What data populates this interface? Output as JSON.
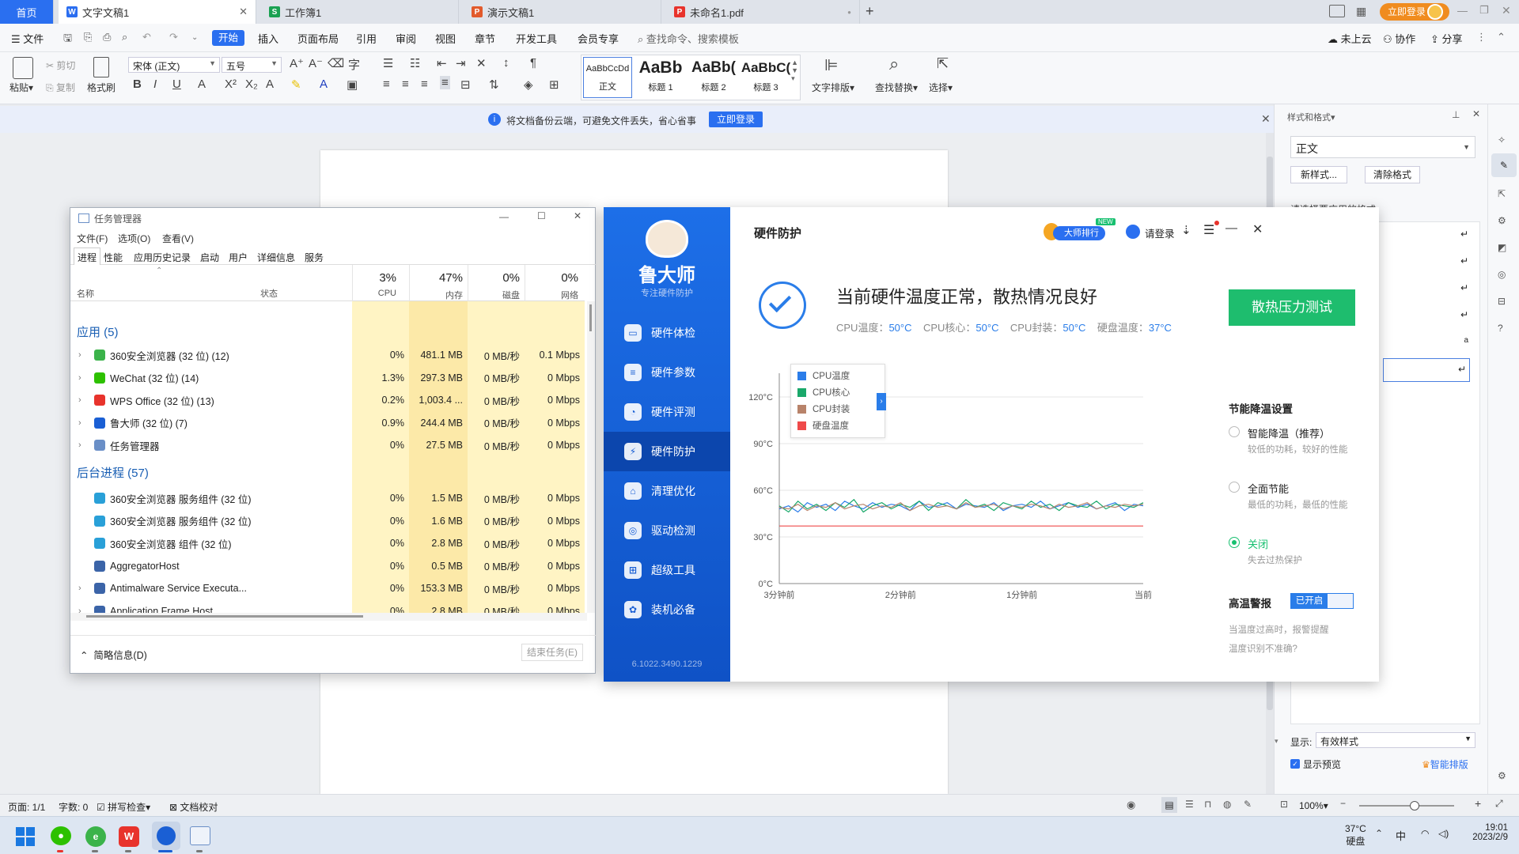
{
  "tabs": [
    {
      "label": "首页",
      "icon": "home"
    },
    {
      "label": "文字文稿1",
      "icon": "W"
    },
    {
      "label": "工作簿1",
      "icon": "S"
    },
    {
      "label": "演示文稿1",
      "icon": "P"
    },
    {
      "label": "未命名1.pdf",
      "icon": "pdf"
    }
  ],
  "titlebar": {
    "login": "立即登录"
  },
  "menu": {
    "file": "文件",
    "start": "开始",
    "items": [
      "插入",
      "页面布局",
      "引用",
      "审阅",
      "视图",
      "章节",
      "开发工具",
      "会员专享"
    ],
    "search": "查找命令、搜索模板",
    "cloud": "未上云",
    "collab": "协作",
    "share": "分享"
  },
  "ribbon": {
    "paste": "粘贴",
    "cut": "剪切",
    "copy": "复制",
    "format_painter": "格式刷",
    "font": "宋体 (正文)",
    "size": "五号",
    "styles": [
      {
        "preview": "AaBbCcDd",
        "label": "正文"
      },
      {
        "preview": "AaBb",
        "label": "标题 1"
      },
      {
        "preview": "AaBb(",
        "label": "标题 2"
      },
      {
        "preview": "AaBbC(",
        "label": "标题 3"
      }
    ],
    "text_layout": "文字排版",
    "find_replace": "查找替换",
    "select": "选择"
  },
  "notice": {
    "text": "将文档备份云端，可避免文件丢失，省心省事",
    "button": "立即登录"
  },
  "styles_pane": {
    "title": "样式和格式",
    "current": "正文",
    "new_style": "新样式...",
    "clear_format": "清除格式",
    "hint": "请选择要应用的格式",
    "show_label": "显示:",
    "show_value": "有效样式",
    "preview": "显示预览",
    "smart": "智能排版"
  },
  "status": {
    "page": "页面: 1/1",
    "words": "字数: 0",
    "spell": "拼写检查",
    "proof": "文档校对",
    "zoom": "100%"
  },
  "taskbar": {
    "temp": "37°C",
    "temp_label": "硬盘",
    "ime": "中",
    "time": "19:01",
    "date": "2023/2/9"
  },
  "task_manager": {
    "title": "任务管理器",
    "menus": [
      "文件(F)",
      "选项(O)",
      "查看(V)"
    ],
    "tabs": [
      "进程",
      "性能",
      "应用历史记录",
      "启动",
      "用户",
      "详细信息",
      "服务"
    ],
    "columns": {
      "name": "名称",
      "status": "状态",
      "cpu_pct": "3%",
      "cpu": "CPU",
      "mem_pct": "47%",
      "mem": "内存",
      "disk_pct": "0%",
      "disk": "磁盘",
      "net_pct": "0%",
      "net": "网络"
    },
    "apps_header": "应用 (5)",
    "apps": [
      {
        "name": "360安全浏览器 (32 位) (12)",
        "cpu": "0%",
        "mem": "481.1 MB",
        "disk": "0 MB/秒",
        "net": "0.1 Mbps",
        "color": "#3bb34a"
      },
      {
        "name": "WeChat (32 位) (14)",
        "cpu": "1.3%",
        "mem": "297.3 MB",
        "disk": "0 MB/秒",
        "net": "0 Mbps",
        "color": "#2dc100"
      },
      {
        "name": "WPS Office (32 位) (13)",
        "cpu": "0.2%",
        "mem": "1,003.4 ...",
        "disk": "0 MB/秒",
        "net": "0 Mbps",
        "color": "#e8332c"
      },
      {
        "name": "鲁大师 (32 位) (7)",
        "cpu": "0.9%",
        "mem": "244.4 MB",
        "disk": "0 MB/秒",
        "net": "0 Mbps",
        "color": "#1a5fd4"
      },
      {
        "name": "任务管理器",
        "cpu": "0%",
        "mem": "27.5 MB",
        "disk": "0 MB/秒",
        "net": "0 Mbps",
        "color": "#6a8fc7"
      }
    ],
    "bg_header": "后台进程 (57)",
    "bg": [
      {
        "name": "360安全浏览器 服务组件 (32 位)",
        "cpu": "0%",
        "mem": "1.5 MB",
        "disk": "0 MB/秒",
        "net": "0 Mbps",
        "color": "#29a0d8"
      },
      {
        "name": "360安全浏览器 服务组件 (32 位)",
        "cpu": "0%",
        "mem": "1.6 MB",
        "disk": "0 MB/秒",
        "net": "0 Mbps",
        "color": "#29a0d8"
      },
      {
        "name": "360安全浏览器 组件 (32 位)",
        "cpu": "0%",
        "mem": "2.8 MB",
        "disk": "0 MB/秒",
        "net": "0 Mbps",
        "color": "#29a0d8"
      },
      {
        "name": "AggregatorHost",
        "cpu": "0%",
        "mem": "0.5 MB",
        "disk": "0 MB/秒",
        "net": "0 Mbps",
        "color": "#3b64a8"
      },
      {
        "name": "Antimalware Service Executa...",
        "cpu": "0%",
        "mem": "153.3 MB",
        "disk": "0 MB/秒",
        "net": "0 Mbps",
        "color": "#3b64a8"
      },
      {
        "name": "Application Frame Host",
        "cpu": "0%",
        "mem": "2.8 MB",
        "disk": "0 MB/秒",
        "net": "0 Mbps",
        "color": "#3b64a8"
      }
    ],
    "fewer": "简略信息(D)",
    "end_task": "结束任务(E)"
  },
  "ludashi": {
    "brand": "鲁大师",
    "slogan": "专注硬件防护",
    "version": "6.1022.3490.1229",
    "nav": [
      "硬件体检",
      "硬件参数",
      "硬件评测",
      "硬件防护",
      "清理优化",
      "驱动检测",
      "超级工具",
      "装机必备"
    ],
    "page_title": "硬件防护",
    "rank": "大师排行",
    "rank_badge": "NEW",
    "login": "请登录",
    "status_title": "当前硬件温度正常，散热情况良好",
    "temps": [
      {
        "label": "CPU温度：",
        "value": "50°C"
      },
      {
        "label": "CPU核心：",
        "value": "50°C"
      },
      {
        "label": "CPU封装：",
        "value": "50°C"
      },
      {
        "label": "硬盘温度：",
        "value": "37°C"
      }
    ],
    "stress_button": "散热压力测试",
    "legend": [
      {
        "name": "CPU温度",
        "color": "#2b7de9"
      },
      {
        "name": "CPU核心",
        "color": "#1aa86a"
      },
      {
        "name": "CPU封装",
        "color": "#b8836a"
      },
      {
        "name": "硬盘温度",
        "color": "#ef4a4a"
      }
    ],
    "y_ticks": [
      "120°C",
      "90°C",
      "60°C",
      "30°C",
      "0°C"
    ],
    "x_ticks": [
      "3分钟前",
      "2分钟前",
      "1分钟前",
      "当前"
    ],
    "cool_title": "节能降温设置",
    "options": [
      {
        "title": "智能降温（推荐）",
        "desc": "较低的功耗，较好的性能",
        "on": false
      },
      {
        "title": "全面节能",
        "desc": "最低的功耗，最低的性能",
        "on": false
      },
      {
        "title": "关闭",
        "desc": "失去过热保护",
        "on": true
      }
    ],
    "alarm_label": "高温警报",
    "alarm_state": "已开启",
    "alarm_desc": "当温度过高时，报警提醒",
    "temp_wrong": "温度识别不准确?"
  },
  "chart_data": {
    "type": "line",
    "title": "",
    "xlabel": "",
    "ylabel": "",
    "ylim": [
      0,
      120
    ],
    "x_ticks": [
      "3分钟前",
      "2分钟前",
      "1分钟前",
      "当前"
    ],
    "series": [
      {
        "name": "CPU温度",
        "values": [
          48,
          50,
          46,
          52,
          49,
          51,
          47,
          53,
          50,
          48,
          52,
          49,
          51,
          50,
          47,
          53,
          49,
          50,
          52,
          48,
          51,
          50,
          49,
          52,
          47,
          50,
          51,
          49,
          53,
          48,
          50,
          52,
          49,
          51,
          48,
          50,
          52,
          47,
          51,
          50
        ]
      },
      {
        "name": "CPU核心",
        "values": [
          50,
          46,
          53,
          48,
          51,
          47,
          52,
          49,
          54,
          46,
          50,
          52,
          48,
          51,
          49,
          53,
          47,
          52,
          50,
          48,
          54,
          49,
          51,
          47,
          52,
          50,
          48,
          53,
          49,
          51,
          47,
          52,
          50,
          49,
          53,
          48,
          51,
          50,
          49,
          52
        ]
      },
      {
        "name": "CPU封装",
        "values": [
          49,
          48,
          51,
          47,
          50,
          49,
          52,
          48,
          50,
          51,
          48,
          50,
          49,
          52,
          47,
          50,
          51,
          49,
          50,
          48,
          52,
          49,
          50,
          51,
          48,
          50,
          49,
          51,
          50,
          48,
          51,
          49,
          50,
          52,
          48,
          50,
          49,
          51,
          50,
          51
        ]
      },
      {
        "name": "硬盘温度",
        "values": [
          37,
          37,
          37,
          37,
          37,
          37,
          37,
          37,
          37,
          37,
          37,
          37,
          37,
          37,
          37,
          37,
          37,
          37,
          37,
          37,
          37,
          37,
          37,
          37,
          37,
          37,
          37,
          37,
          37,
          37,
          37,
          37,
          37,
          37,
          37,
          37,
          37,
          37,
          37,
          37
        ]
      }
    ]
  }
}
